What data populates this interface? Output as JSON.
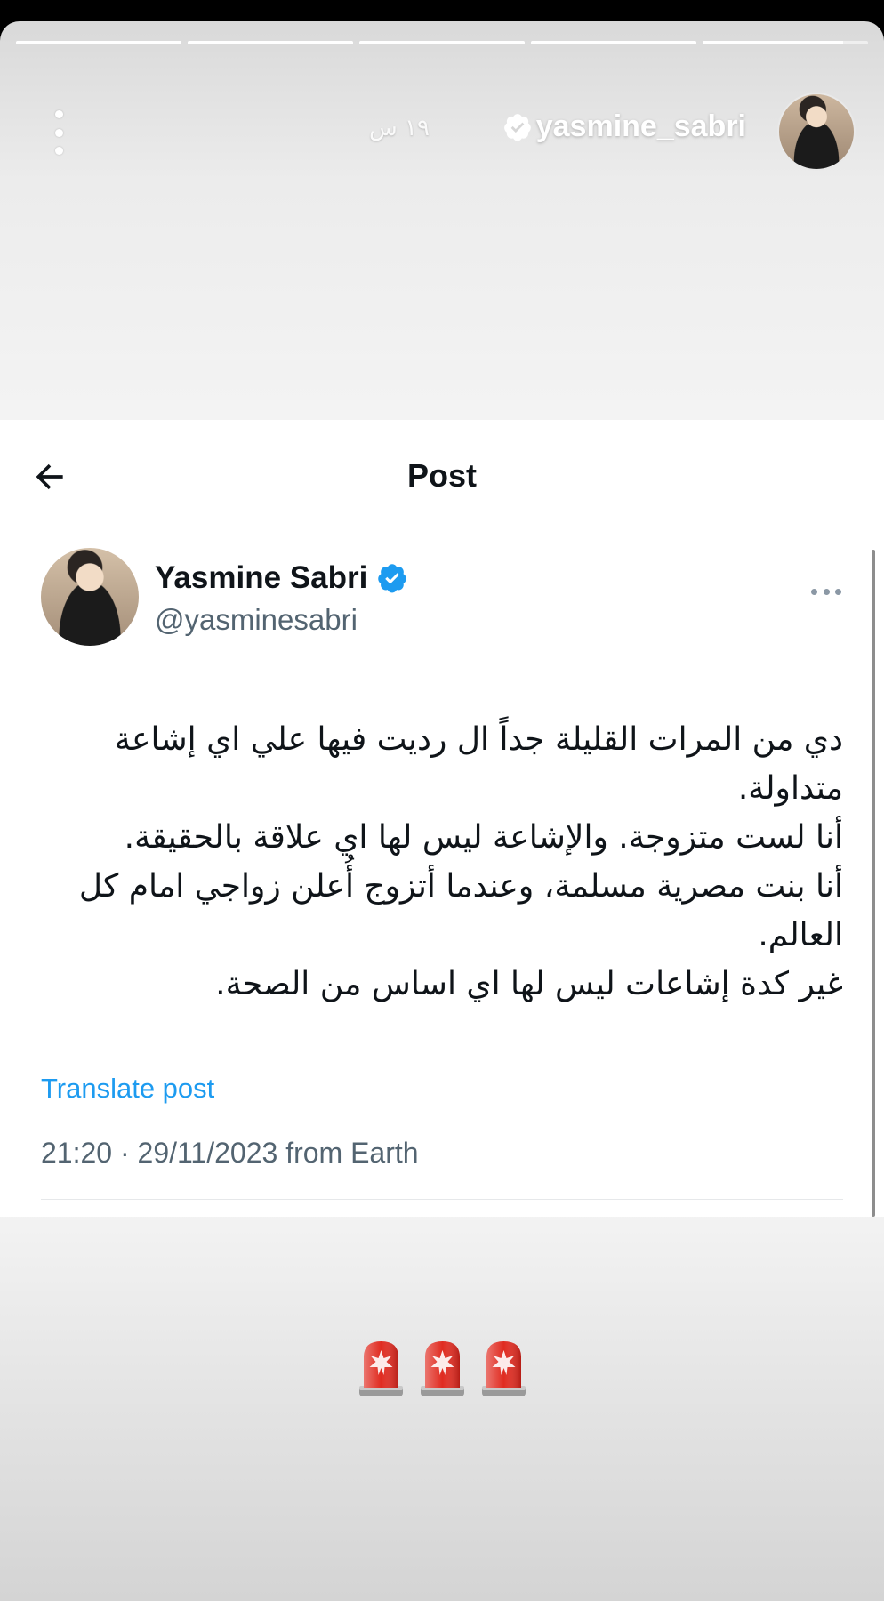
{
  "story": {
    "progress_segments": [
      1,
      1,
      1,
      1,
      0.85
    ],
    "username": "yasmine_sabri",
    "time": "١٩ س",
    "verified": true
  },
  "tweet": {
    "header_title": "Post",
    "author_name": "Yasmine Sabri",
    "author_handle": "@yasminesabri",
    "verified_color": "#1d9bf0",
    "body_lines": [
      "دي من المرات القليلة جداً ال رديت فيها علي اي إشاعة متداولة.",
      "أنا لست متزوجة. والإشاعة ليس لها اي علاقة بالحقيقة.",
      "أنا بنت مصرية مسلمة، وعندما أتزوج أُعلن زواجي امام كل العالم.",
      "غير كدة إشاعات ليس لها اي اساس من الصحة."
    ],
    "translate_label": "Translate post",
    "meta": "21:20 · 29/11/2023 from Earth"
  },
  "stickers": {
    "emoji": [
      "siren-icon",
      "siren-icon",
      "siren-icon"
    ]
  }
}
